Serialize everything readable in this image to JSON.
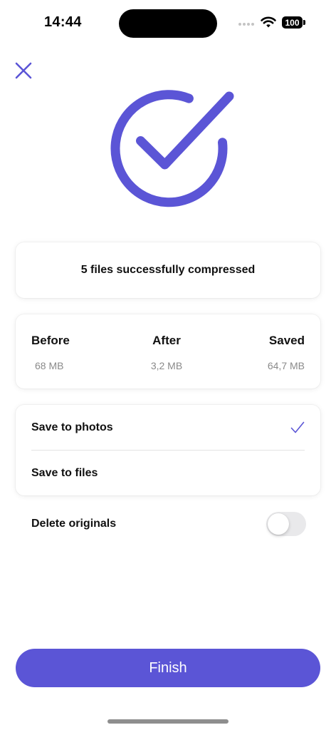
{
  "status_bar": {
    "time": "14:44",
    "battery": "100"
  },
  "colors": {
    "accent": "#5b55d6",
    "text": "#111111",
    "secondary_text": "#8a8a8a"
  },
  "icons": {
    "close": "close-icon",
    "success": "checkmark-circle-icon",
    "selected": "checkmark-icon"
  },
  "summary": {
    "text": "5 files successfully compressed"
  },
  "stats": {
    "before": {
      "label": "Before",
      "value": "68 MB"
    },
    "after": {
      "label": "After",
      "value": "3,2 MB"
    },
    "saved": {
      "label": "Saved",
      "value": "64,7 MB"
    }
  },
  "save_options": {
    "photos": {
      "label": "Save to photos",
      "selected": true
    },
    "files": {
      "label": "Save to files",
      "selected": false
    }
  },
  "delete_originals": {
    "label": "Delete originals",
    "enabled": false
  },
  "finish_button": {
    "label": "Finish"
  }
}
